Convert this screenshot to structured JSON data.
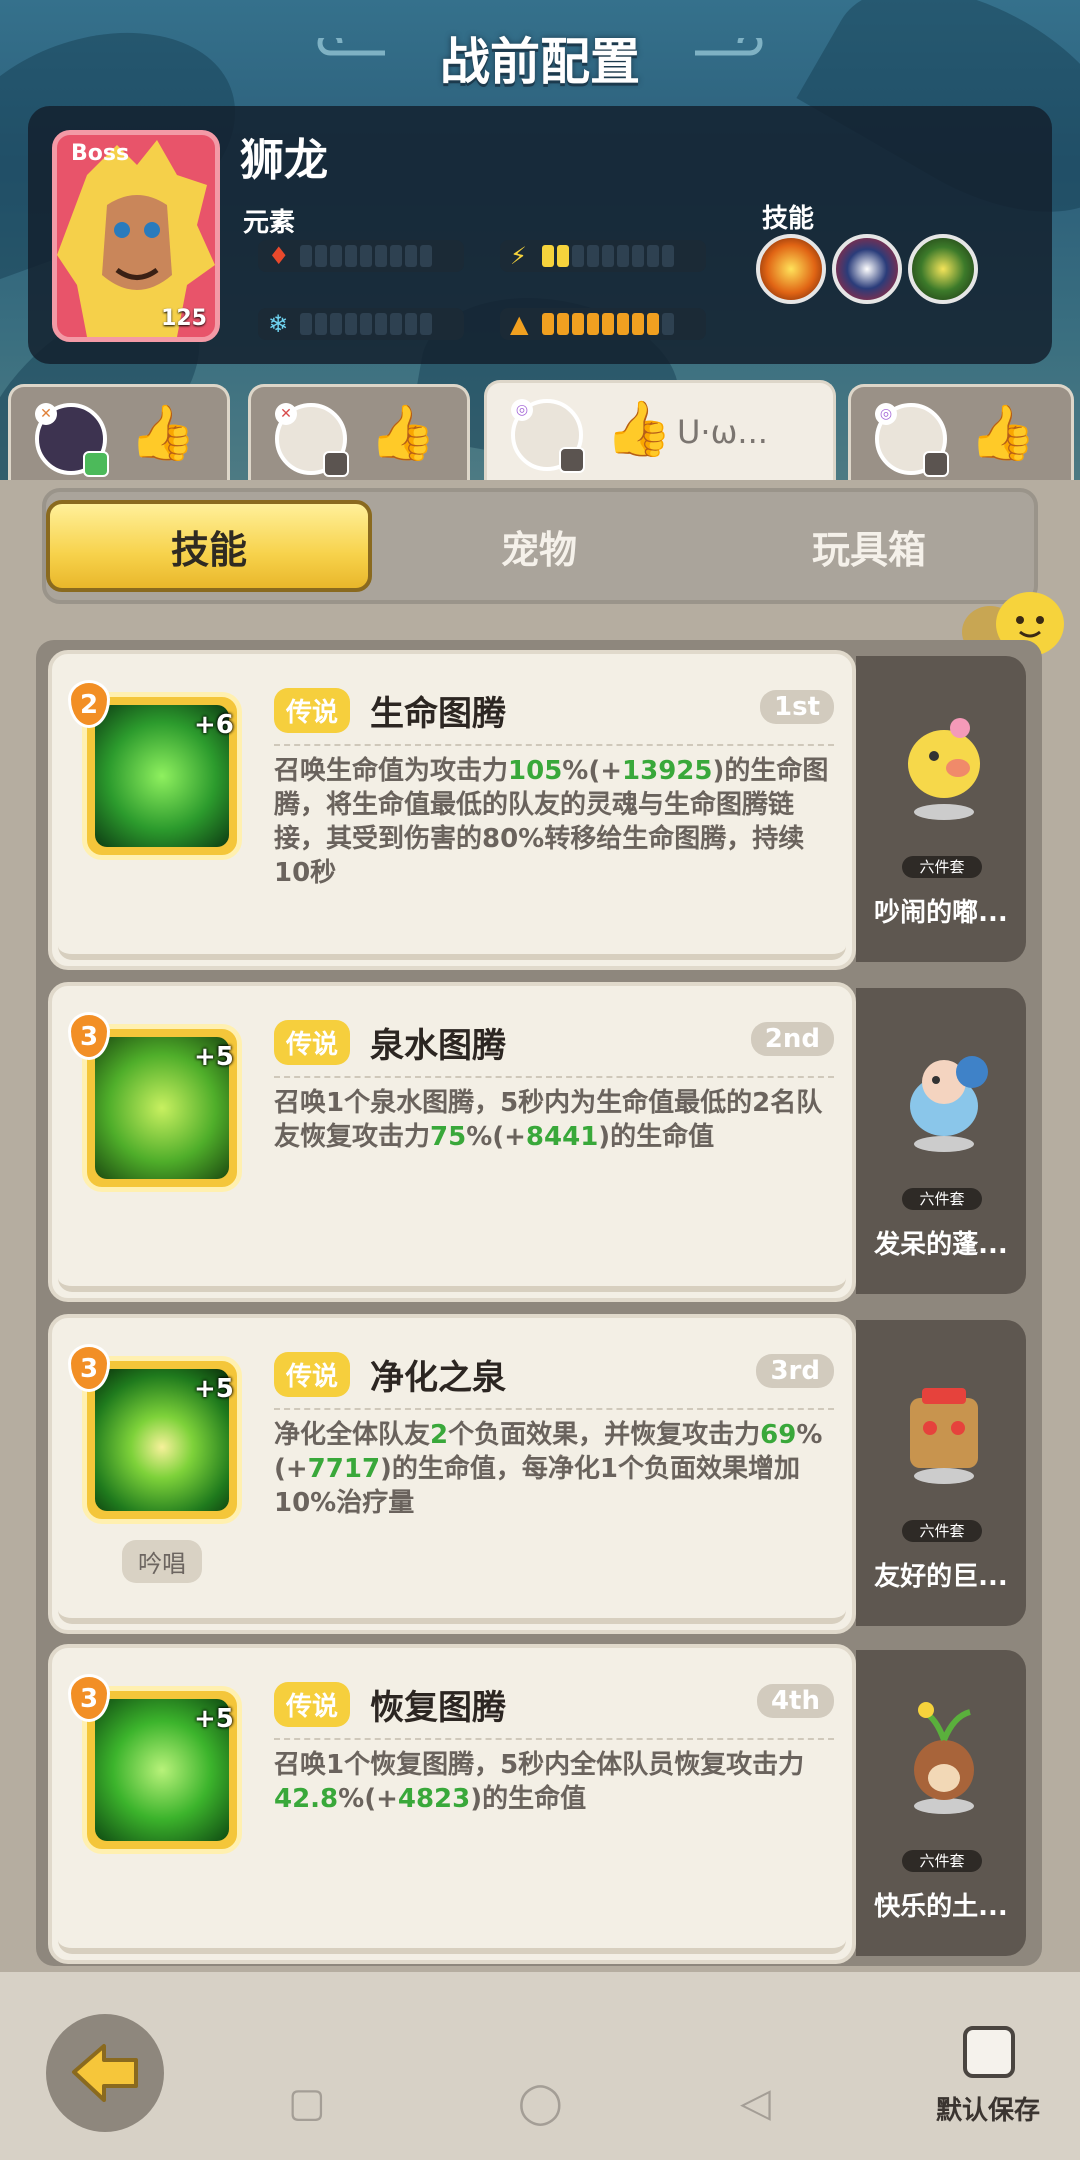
{
  "title": "战前配置",
  "boss": {
    "tag": "Boss",
    "name": "狮龙",
    "level": "125",
    "element_label": "元素",
    "skill_label": "技能"
  },
  "players": [
    {
      "id": "player-1",
      "tag": ""
    },
    {
      "id": "player-2",
      "tag": ""
    },
    {
      "id": "player-3",
      "tag": "U·ω..."
    },
    {
      "id": "player-4",
      "tag": ""
    }
  ],
  "tabs": {
    "skills": "技能",
    "pets": "宠物",
    "toybox": "玩具箱"
  },
  "chat_label": "聊天",
  "skills": [
    {
      "level": "2",
      "plus": "+6",
      "rarity": "传说",
      "name": "生命图腾",
      "rank": "1st",
      "desc_a": "召唤生命值为攻击力",
      "desc_g1": "105",
      "desc_b": "%(+",
      "desc_g2": "13925",
      "desc_c": ")的生命图腾，将生命值最低的队友的灵魂与生命图腾链接，其受到伤害的80%转移给生命图腾，持续10秒",
      "pet_set": "六件套",
      "pet_name": "吵闹的嘟..."
    },
    {
      "level": "3",
      "plus": "+5",
      "rarity": "传说",
      "name": "泉水图腾",
      "rank": "2nd",
      "desc_a": "召唤1个泉水图腾，5秒内为生命值最低的2名队友恢复攻击力",
      "desc_g1": "75",
      "desc_b": "%(+",
      "desc_g2": "8441",
      "desc_c": ")的生命值",
      "pet_set": "六件套",
      "pet_name": "发呆的蓬..."
    },
    {
      "level": "3",
      "plus": "+5",
      "rarity": "传说",
      "name": "净化之泉",
      "rank": "3rd",
      "desc_a": "净化全体队友",
      "desc_g0": "2",
      "desc_a2": "个负面效果，并恢复攻击力",
      "desc_g1": "69",
      "desc_b": "%(+",
      "desc_g2": "7717",
      "desc_c": ")的生命值，每净化1个负面效果增加10%治疗量",
      "chant": "吟唱",
      "pet_set": "六件套",
      "pet_name": "友好的巨..."
    },
    {
      "level": "3",
      "plus": "+5",
      "rarity": "传说",
      "name": "恢复图腾",
      "rank": "4th",
      "desc_a": "召唤1个恢复图腾，5秒内全体队员恢复攻击力",
      "desc_g1": "42.8",
      "desc_b": "%(+",
      "desc_g2": "4823",
      "desc_c": ")的生命值",
      "pet_set": "六件套",
      "pet_name": "快乐的土..."
    }
  ],
  "save_label": "默认保存"
}
